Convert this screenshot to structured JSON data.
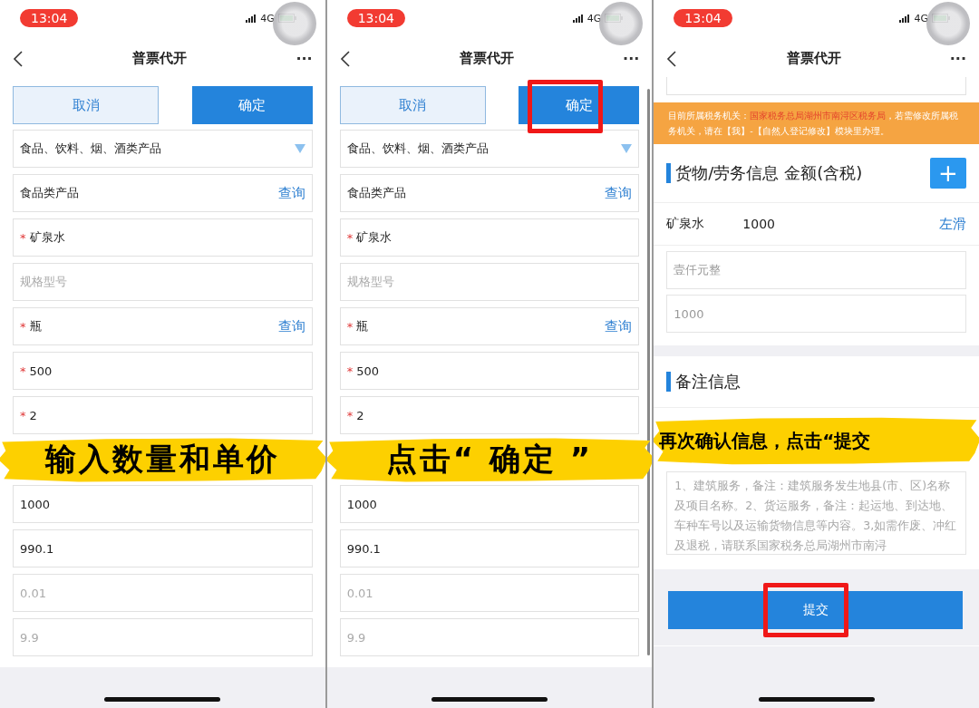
{
  "panels": [
    {
      "kind": "form",
      "status_time": "13:04",
      "network": "4G",
      "title": "普票代开",
      "more": "···",
      "cancel": "取消",
      "confirm": "确定",
      "confirm_highlighted": false,
      "caption": "输入数量和单价",
      "rows": [
        {
          "kind": "select",
          "value": "食品、饮料、烟、酒类产品"
        },
        {
          "kind": "lookup",
          "value": "食品类产品",
          "action": "查询"
        },
        {
          "kind": "text",
          "mark": "*",
          "value": "矿泉水"
        },
        {
          "kind": "text",
          "placeholder": "规格型号"
        },
        {
          "kind": "lookup",
          "mark": "*",
          "value": "瓶",
          "action": "查询"
        },
        {
          "kind": "text",
          "mark": "*",
          "value": "500"
        },
        {
          "kind": "text",
          "mark": "*",
          "value": "2"
        },
        {
          "kind": "hidden"
        },
        {
          "kind": "text",
          "value": "1000"
        },
        {
          "kind": "text",
          "value": "990.1"
        },
        {
          "kind": "text",
          "placeholder": "0.01"
        },
        {
          "kind": "text",
          "placeholder": "9.9"
        }
      ]
    },
    {
      "kind": "form",
      "status_time": "13:04",
      "network": "4G",
      "title": "普票代开",
      "more": "···",
      "cancel": "取消",
      "confirm": "确定",
      "confirm_highlighted": true,
      "scrollbar": true,
      "caption": "点击“ 确定 ”",
      "rows": [
        {
          "kind": "select",
          "value": "食品、饮料、烟、酒类产品"
        },
        {
          "kind": "lookup",
          "value": "食品类产品",
          "action": "查询"
        },
        {
          "kind": "text",
          "mark": "*",
          "value": "矿泉水"
        },
        {
          "kind": "text",
          "placeholder": "规格型号"
        },
        {
          "kind": "lookup",
          "mark": "*",
          "value": "瓶",
          "action": "查询"
        },
        {
          "kind": "text",
          "mark": "*",
          "value": "500"
        },
        {
          "kind": "text",
          "mark": "*",
          "value": "2"
        },
        {
          "kind": "hidden"
        },
        {
          "kind": "text",
          "value": "1000"
        },
        {
          "kind": "text",
          "value": "990.1"
        },
        {
          "kind": "text",
          "placeholder": "0.01"
        },
        {
          "kind": "text",
          "placeholder": "9.9"
        }
      ]
    },
    {
      "kind": "confirm",
      "status_time": "13:04",
      "network": "4G",
      "title": "普票代开",
      "more": "···",
      "caption": "再次确认信息，点击“提交",
      "notice": {
        "prefix": "目前所属税务机关：",
        "office": "国家税务总局湖州市南浔区税务局",
        "suffix": "，若需修改所属税务机关，请在【我】-【自然人登记修改】模块里办理。"
      },
      "goods_heading": "货物/劳务信息 金额(含税)",
      "add_button": "+",
      "item": {
        "name": "矿泉水",
        "amount": "1000",
        "action": "左滑"
      },
      "fields": [
        {
          "value": "壹仟元整",
          "disabled": true
        },
        {
          "value": "1000",
          "disabled": true
        }
      ],
      "remarks_heading": "备注信息",
      "remarks_placeholder": "1、建筑服务，备注：建筑服务发生地县(市、区)名称及项目名称。2、货运服务，备注：起运地、到达地、车种车号以及运输货物信息等内容。3,如需作废、冲红及退税，请联系国家税务总局湖州市南浔",
      "submit": "提交",
      "submit_highlighted": true
    }
  ]
}
